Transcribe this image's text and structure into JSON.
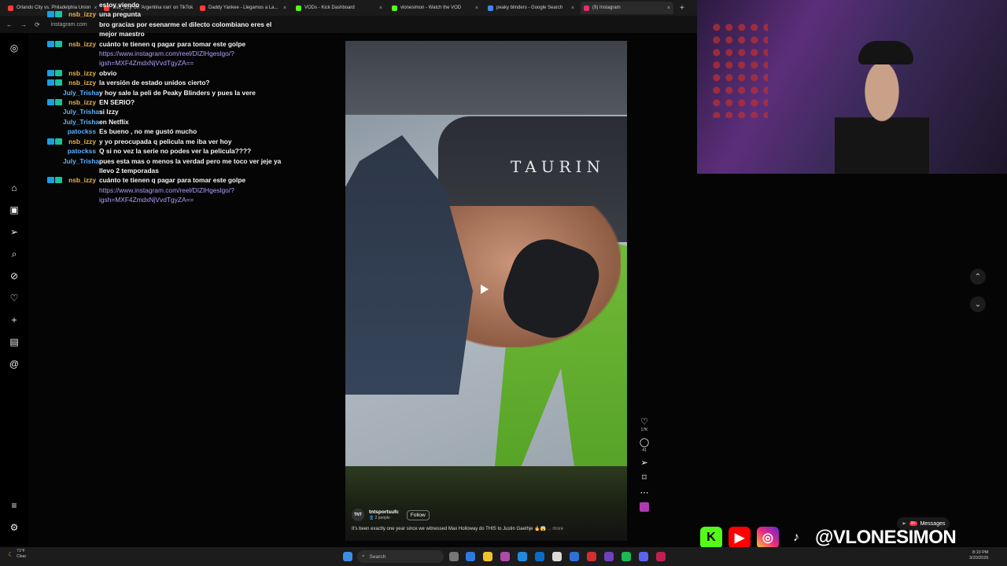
{
  "browser": {
    "tabs": [
      {
        "label": "Orlando City vs. Philadelphia Union",
        "color": "#ff3b3b"
      },
      {
        "label": "'nsb_izzy' on 'Argentina iran' on TikTok",
        "color": "#ff3b3b"
      },
      {
        "label": "Daddy Yankee - Llegamos a La...",
        "color": "#ff3b3b"
      },
      {
        "label": "VODs - Kick Dashboard",
        "color": "#53fc18"
      },
      {
        "label": "vlonesimon - Watch the VOD",
        "color": "#53fc18"
      },
      {
        "label": "peaky blinders - Google Search",
        "color": "#4285f4"
      },
      {
        "label": "(9) Instagram",
        "color": "#e1306c"
      }
    ],
    "url": "instagram.com"
  },
  "chat": [
    {
      "user": "",
      "text": "estoy viendo",
      "color": "#ffffff",
      "badge": false
    },
    {
      "user": "nsb_izzy",
      "text": "una pregunta",
      "color": "#e8b64a",
      "badge": true
    },
    {
      "user": "",
      "text": "bro gracias por esenarme el dilecto colombiano eres el mejor maestro",
      "color": "#ff4040",
      "badge": false
    },
    {
      "user": "nsb_izzy",
      "text": "cuánto te tienen q pagar para tomar este golpe",
      "link": "https://www.instagram.com/reel/DIZlHgeslgo/?igsh=MXF4ZmdxNjVvdTgyZA==",
      "color": "#e8b64a",
      "badge": true
    },
    {
      "user": "nsb_izzy",
      "text": "obvio",
      "color": "#e8b64a",
      "badge": true
    },
    {
      "user": "nsb_izzy",
      "text": "la versión de estado unidos cierto?",
      "color": "#e8b64a",
      "badge": true
    },
    {
      "user": "July_Trisha",
      "text": "y hoy sale la peli de Peaky Blinders y pues la vere",
      "color": "#5ab0ff",
      "badge": false
    },
    {
      "user": "nsb_izzy",
      "text": "EN SERIO?",
      "color": "#e8b64a",
      "badge": true
    },
    {
      "user": "July_Trisha",
      "text": "si Izzy",
      "color": "#5ab0ff",
      "badge": false
    },
    {
      "user": "July_Trisha",
      "text": "en Netflix",
      "color": "#5ab0ff",
      "badge": false
    },
    {
      "user": "patockss",
      "text": "Es bueno , no me gustó mucho",
      "color": "#5ab0ff",
      "badge": false
    },
    {
      "user": "nsb_izzy",
      "text": "y yo preocupada q pelicula me iba ver hoy",
      "color": "#e8b64a",
      "badge": true
    },
    {
      "user": "patockss",
      "text": "Q si no vez la serie no podes ver la pelicula????",
      "color": "#5ab0ff",
      "badge": false
    },
    {
      "user": "July_Trisha",
      "text": "pues esta mas o menos la verdad pero me toco ver jeje ya llevo 2 temporadas",
      "color": "#5ab0ff",
      "badge": false
    },
    {
      "user": "nsb_izzy",
      "text": "cuánto te tienen q pagar para tomar este golpe",
      "link": "https://www.instagram.com/reel/DIZlHgeslgo/?igsh=MXF4ZmdxNjVvdTgyZA==",
      "color": "#e8b64a",
      "badge": true
    }
  ],
  "reel": {
    "can_text": "TAURIN",
    "likes": "17K",
    "comments": "41",
    "account": "tntsportsufc",
    "account_sub": "2 people",
    "avatar": "TNT",
    "follow_label": "Follow",
    "caption": "It's been exactly one year since we witnessed Max Holloway do THIS to Justin Gaethje 🔥😱",
    "more": "... more"
  },
  "overlay": {
    "handle": "@VLONESIMON",
    "messages_label": "Messages",
    "messages_badge": "9+"
  },
  "taskbar": {
    "weather_temp": "71°F",
    "weather_cond": "Clear",
    "search_placeholder": "Search",
    "time": "8:10 PM",
    "date": "3/20/2026"
  }
}
